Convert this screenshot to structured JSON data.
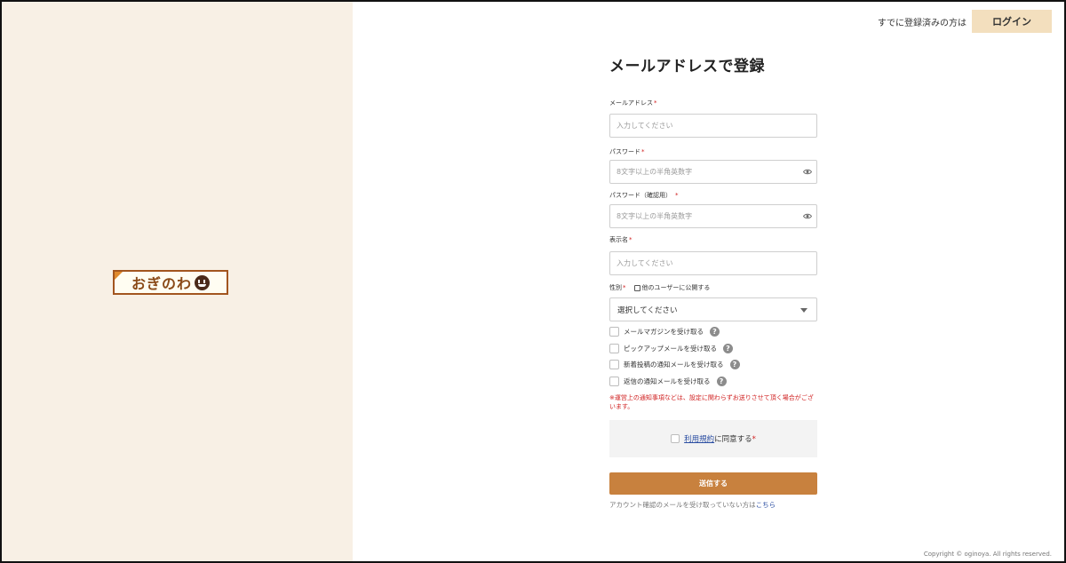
{
  "brand": {
    "logo_text": "おぎのわ"
  },
  "header": {
    "login_prompt": "すでに登録済みの方は",
    "login_label": "ログイン"
  },
  "form": {
    "title": "メールアドレスで登録",
    "required_mark": "*",
    "email": {
      "label": "メールアドレス",
      "placeholder": "入力してください",
      "value": ""
    },
    "password": {
      "label": "パスワード",
      "placeholder": "8文字以上の半角英数字",
      "value": ""
    },
    "password_confirm": {
      "label": "パスワード（確認用）",
      "placeholder": "8文字以上の半角英数字",
      "value": ""
    },
    "display_name": {
      "label": "表示名",
      "placeholder": "入力してください",
      "value": ""
    },
    "gender": {
      "label": "性別",
      "public_label": "他のユーザーに公開する",
      "selected": "選択してください"
    },
    "subscriptions": [
      {
        "label": "メールマガジンを受け取る",
        "checked": false
      },
      {
        "label": "ピックアップメールを受け取る",
        "checked": false
      },
      {
        "label": "新着投稿の通知メールを受け取る",
        "checked": false
      },
      {
        "label": "返信の通知メールを受け取る",
        "checked": false
      }
    ],
    "help_glyph": "?",
    "notice": "※運営上の通知事項などは、設定に関わらずお送りさせて頂く場合がございます。",
    "agree": {
      "link_text": "利用規約",
      "text": "に同意する"
    },
    "submit_label": "送信する",
    "resend": {
      "text": "アカウント確認のメールを受け取っていない方は",
      "link": "こちら"
    }
  },
  "footer": {
    "copyright": "Copyright © oginoya. All rights reserved."
  },
  "colors": {
    "left_panel": "#f8f0e5",
    "accent": "#c8813e",
    "login_button": "#f3dfbe",
    "required": "#d02020",
    "link": "#2b4ea2"
  }
}
